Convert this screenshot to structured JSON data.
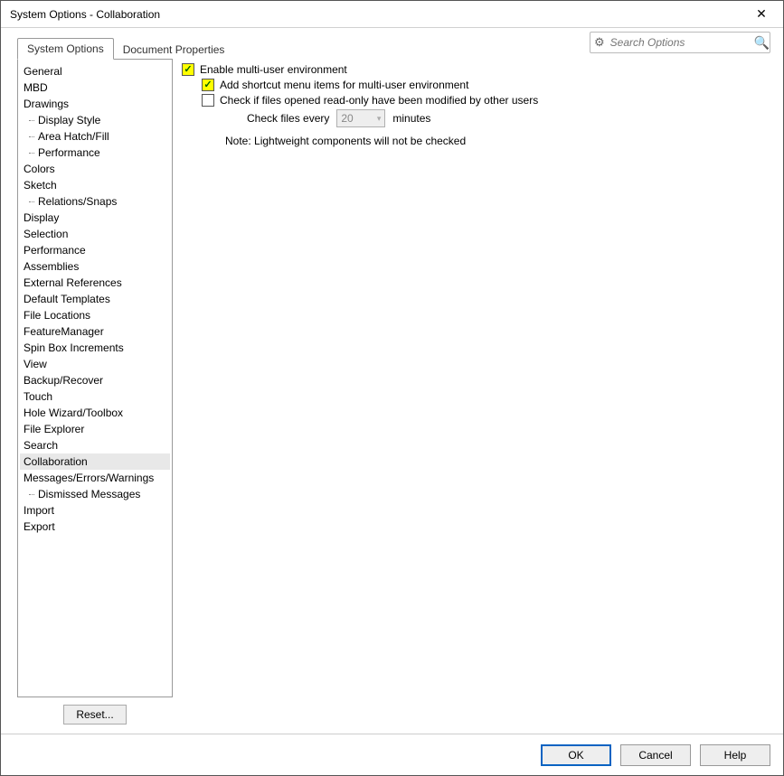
{
  "window": {
    "title": "System Options - Collaboration",
    "close": "✕"
  },
  "tabs": {
    "system_options": "System Options",
    "document_properties": "Document Properties"
  },
  "search": {
    "placeholder": "Search Options"
  },
  "tree": {
    "items": [
      {
        "label": "General",
        "level": 0
      },
      {
        "label": "MBD",
        "level": 0
      },
      {
        "label": "Drawings",
        "level": 0
      },
      {
        "label": "Display Style",
        "level": 1
      },
      {
        "label": "Area Hatch/Fill",
        "level": 1
      },
      {
        "label": "Performance",
        "level": 1
      },
      {
        "label": "Colors",
        "level": 0
      },
      {
        "label": "Sketch",
        "level": 0
      },
      {
        "label": "Relations/Snaps",
        "level": 1
      },
      {
        "label": "Display",
        "level": 0
      },
      {
        "label": "Selection",
        "level": 0
      },
      {
        "label": "Performance",
        "level": 0
      },
      {
        "label": "Assemblies",
        "level": 0
      },
      {
        "label": "External References",
        "level": 0
      },
      {
        "label": "Default Templates",
        "level": 0
      },
      {
        "label": "File Locations",
        "level": 0
      },
      {
        "label": "FeatureManager",
        "level": 0
      },
      {
        "label": "Spin Box Increments",
        "level": 0
      },
      {
        "label": "View",
        "level": 0
      },
      {
        "label": "Backup/Recover",
        "level": 0
      },
      {
        "label": "Touch",
        "level": 0
      },
      {
        "label": "Hole Wizard/Toolbox",
        "level": 0
      },
      {
        "label": "File Explorer",
        "level": 0
      },
      {
        "label": "Search",
        "level": 0
      },
      {
        "label": "Collaboration",
        "level": 0,
        "selected": true
      },
      {
        "label": "Messages/Errors/Warnings",
        "level": 0
      },
      {
        "label": "Dismissed Messages",
        "level": 1
      },
      {
        "label": "Import",
        "level": 0
      },
      {
        "label": "Export",
        "level": 0
      }
    ]
  },
  "reset_label": "Reset...",
  "options": {
    "enable_multiuser": {
      "checked": true,
      "label": "Enable multi-user environment"
    },
    "add_shortcut": {
      "checked": true,
      "label": "Add shortcut menu items for multi-user environment"
    },
    "check_modified": {
      "checked": false,
      "label": "Check if files opened read-only have been modified by other users"
    },
    "check_every_prefix": "Check files every",
    "check_every_value": "20",
    "check_every_suffix": "minutes",
    "note": "Note: Lightweight components will not be checked"
  },
  "footer": {
    "ok": "OK",
    "cancel": "Cancel",
    "help": "Help"
  }
}
